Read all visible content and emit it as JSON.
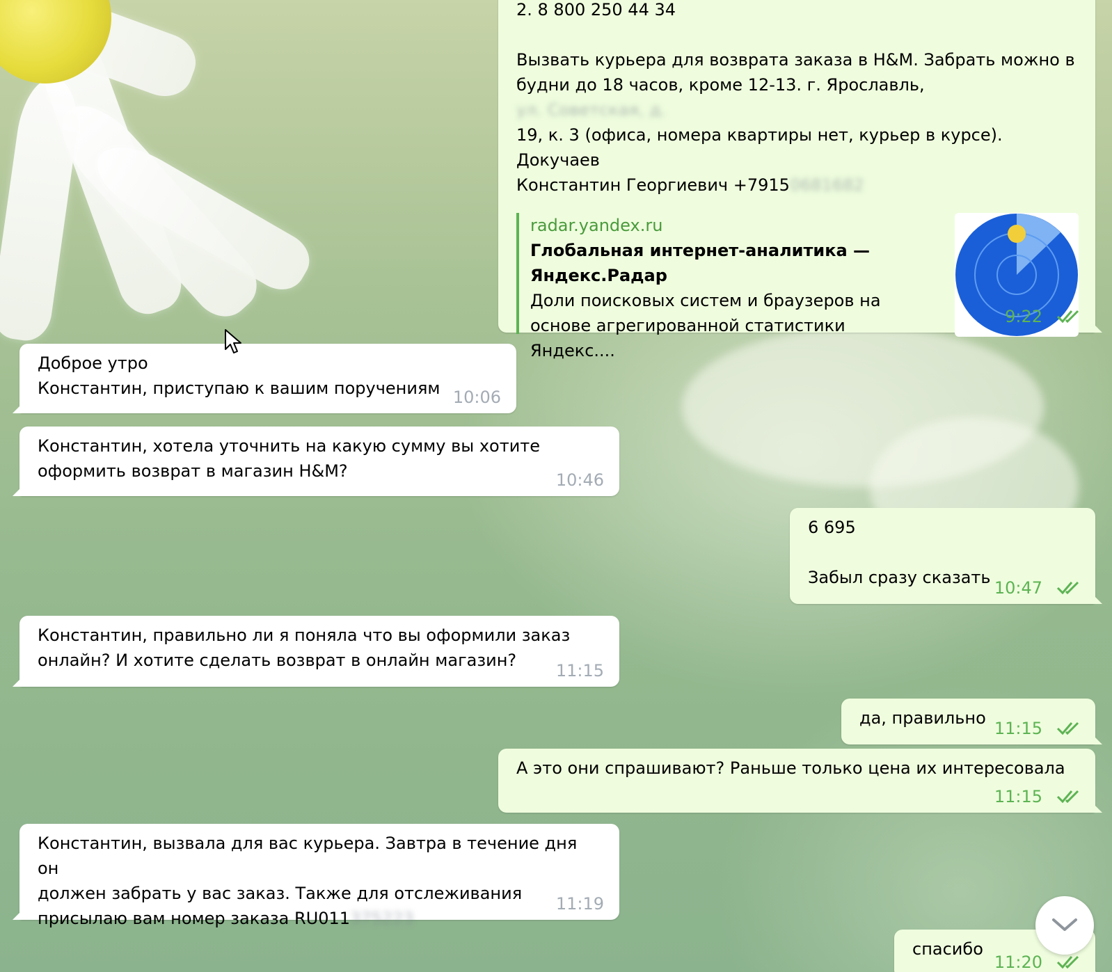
{
  "messages": [
    {
      "direction": "out",
      "text_lines": [
        "2. 8 800 250 44 34",
        "",
        "Вызвать курьера для возврата заказа в H&M. Забрать можно в",
        "будни до 18 часов, кроме 12-13. г. Ярославль,",
        "19, к. 3 (офиса, номера квартиры нет, курьер в курсе). Докучаев",
        "Константин Георгиевич +7915"
      ],
      "blurred_address": "ул. Советская, д.",
      "blurred_phone": "0681682",
      "link_preview": {
        "site": "radar.yandex.ru",
        "title_line1": "Глобальная интернет-аналитика —",
        "title_line2": "Яндекс.Радар",
        "desc_line1": "Доли поисковых систем и браузеров на",
        "desc_line2": "основе агрегированной статистики Яндекс...."
      },
      "time": "9:22",
      "read": true
    },
    {
      "direction": "in",
      "text": "Доброе утро\nКонстантин, приступаю к вашим поручениям",
      "time": "10:06"
    },
    {
      "direction": "in",
      "text": "Константин, хотела уточнить на какую сумму вы хотите\nоформить возврат в магазин H&M?",
      "time": "10:46"
    },
    {
      "direction": "out",
      "text": "6 695\n\nЗабыл сразу сказать",
      "time": "10:47",
      "read": true
    },
    {
      "direction": "in",
      "text": "Константин, правильно ли я поняла что вы оформили заказ\nонлайн? И хотите сделать возврат в онлайн магазин?",
      "time": "11:15"
    },
    {
      "direction": "out",
      "text": "да, правильно",
      "time": "11:15",
      "read": true
    },
    {
      "direction": "out",
      "text": "А это они спрашивают? Раньше только цена их интересовала",
      "time": "11:15",
      "read": true
    },
    {
      "direction": "in",
      "text_lines": [
        "Константин, вызвала для вас курьера. Завтра в течение дня он",
        "должен забрать у вас заказ. Также для отслеживания",
        "присылаю вам номер заказа RU011"
      ],
      "blurred_order": "375223",
      "time": "11:19"
    },
    {
      "direction": "out",
      "text": "спасибо",
      "time": "11:20",
      "read": true
    }
  ],
  "icons": {
    "read_ticks": "double-check-icon",
    "scroll_down": "chevron-down-icon",
    "cursor": "mouse-pointer-icon",
    "link_thumb": "yandex-radar-logo"
  },
  "colors": {
    "incoming_bubble": "#ffffff",
    "outgoing_bubble": "#effdde",
    "outgoing_time": "#5db353",
    "incoming_time": "#a3abb4",
    "link_accent": "#5db353"
  }
}
